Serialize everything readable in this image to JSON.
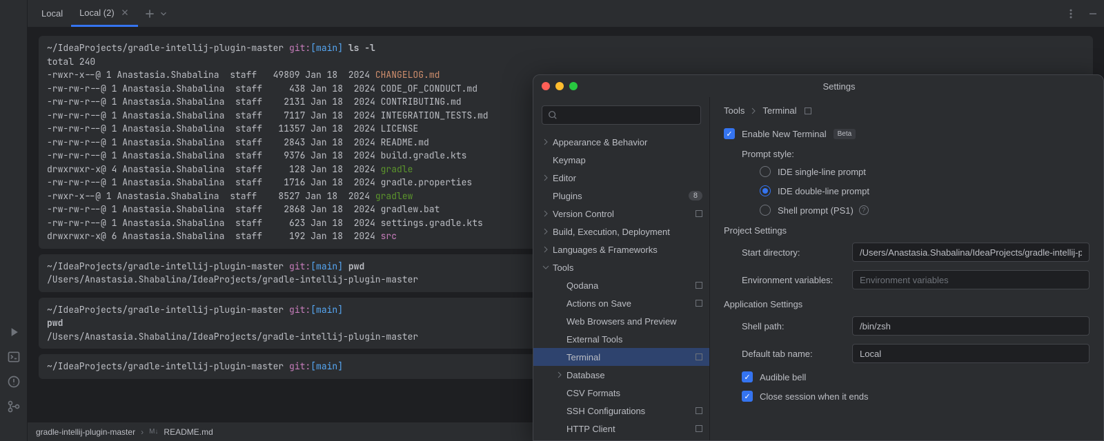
{
  "tabs": {
    "local_label": "Local",
    "local2_label": "Local (2)"
  },
  "terminal": {
    "prompt_path": "~/IdeaProjects/gradle-intellij-plugin-master",
    "git_label": "git:",
    "branch": "[main]",
    "cmd_ls": "ls -l",
    "cmd_pwd": "pwd",
    "total_line": "total 240",
    "pwd_output": "/Users/Anastasia.Shabalina/IdeaProjects/gradle-intellij-plugin-master",
    "files": [
      {
        "perm": "-rwxr-x--@",
        "n": "1",
        "owner": "Anastasia.Shabalina",
        "grp": "staff",
        "size": "49809",
        "date": "Jan 18  2024",
        "name": "CHANGELOG.md",
        "cls": "file-md"
      },
      {
        "perm": "-rw-rw-r--@",
        "n": "1",
        "owner": "Anastasia.Shabalina",
        "grp": "staff",
        "size": "438",
        "date": "Jan 18  2024",
        "name": "CODE_OF_CONDUCT.md",
        "cls": "file-reg"
      },
      {
        "perm": "-rw-rw-r--@",
        "n": "1",
        "owner": "Anastasia.Shabalina",
        "grp": "staff",
        "size": "2131",
        "date": "Jan 18  2024",
        "name": "CONTRIBUTING.md",
        "cls": "file-reg"
      },
      {
        "perm": "-rw-rw-r--@",
        "n": "1",
        "owner": "Anastasia.Shabalina",
        "grp": "staff",
        "size": "7117",
        "date": "Jan 18  2024",
        "name": "INTEGRATION_TESTS.md",
        "cls": "file-reg"
      },
      {
        "perm": "-rw-rw-r--@",
        "n": "1",
        "owner": "Anastasia.Shabalina",
        "grp": "staff",
        "size": "11357",
        "date": "Jan 18  2024",
        "name": "LICENSE",
        "cls": "file-reg"
      },
      {
        "perm": "-rw-rw-r--@",
        "n": "1",
        "owner": "Anastasia.Shabalina",
        "grp": "staff",
        "size": "2843",
        "date": "Jan 18  2024",
        "name": "README.md",
        "cls": "file-reg"
      },
      {
        "perm": "-rw-rw-r--@",
        "n": "1",
        "owner": "Anastasia.Shabalina",
        "grp": "staff",
        "size": "9376",
        "date": "Jan 18  2024",
        "name": "build.gradle.kts",
        "cls": "file-reg"
      },
      {
        "perm": "drwxrwxr-x@",
        "n": "4",
        "owner": "Anastasia.Shabalina",
        "grp": "staff",
        "size": "128",
        "date": "Jan 18  2024",
        "name": "gradle",
        "cls": "file-exec"
      },
      {
        "perm": "-rw-rw-r--@",
        "n": "1",
        "owner": "Anastasia.Shabalina",
        "grp": "staff",
        "size": "1716",
        "date": "Jan 18  2024",
        "name": "gradle.properties",
        "cls": "file-reg"
      },
      {
        "perm": "-rwxr-x--@",
        "n": "1",
        "owner": "Anastasia.Shabalina",
        "grp": "staff",
        "size": "8527",
        "date": "Jan 18  2024",
        "name": "gradlew",
        "cls": "file-exec"
      },
      {
        "perm": "-rw-rw-r--@",
        "n": "1",
        "owner": "Anastasia.Shabalina",
        "grp": "staff",
        "size": "2868",
        "date": "Jan 18  2024",
        "name": "gradlew.bat",
        "cls": "file-reg"
      },
      {
        "perm": "-rw-rw-r--@",
        "n": "1",
        "owner": "Anastasia.Shabalina",
        "grp": "staff",
        "size": "623",
        "date": "Jan 18  2024",
        "name": "settings.gradle.kts",
        "cls": "file-reg"
      },
      {
        "perm": "drwxrwxr-x@",
        "n": "6",
        "owner": "Anastasia.Shabalina",
        "grp": "staff",
        "size": "192",
        "date": "Jan 18  2024",
        "name": "src",
        "cls": "file-dir"
      }
    ]
  },
  "status": {
    "project": "gradle-intellij-plugin-master",
    "md_prefix": "M↓",
    "readme": "README.md"
  },
  "settings": {
    "title": "Settings",
    "breadcrumb": {
      "parent": "Tools",
      "current": "Terminal"
    },
    "tree": {
      "appearance": "Appearance & Behavior",
      "keymap": "Keymap",
      "editor": "Editor",
      "plugins": "Plugins",
      "plugins_badge": "8",
      "version_control": "Version Control",
      "build": "Build, Execution, Deployment",
      "languages": "Languages & Frameworks",
      "tools": "Tools",
      "qodana": "Qodana",
      "actions_save": "Actions on Save",
      "web_browsers": "Web Browsers and Preview",
      "external_tools": "External Tools",
      "terminal": "Terminal",
      "database": "Database",
      "csv": "CSV Formats",
      "ssh": "SSH Configurations",
      "http": "HTTP Client"
    },
    "form": {
      "enable_new": "Enable New Terminal",
      "beta": "Beta",
      "prompt_style": "Prompt style:",
      "radio_single": "IDE single-line prompt",
      "radio_double": "IDE double-line prompt",
      "radio_shell": "Shell prompt (PS1)",
      "project_settings": "Project Settings",
      "start_dir": "Start directory:",
      "start_dir_value": "/Users/Anastasia.Shabalina/IdeaProjects/gradle-intellij-plu",
      "env_vars": "Environment variables:",
      "env_placeholder": "Environment variables",
      "app_settings": "Application Settings",
      "shell_path": "Shell path:",
      "shell_path_value": "/bin/zsh",
      "default_tab": "Default tab name:",
      "default_tab_value": "Local",
      "audible": "Audible bell",
      "close_session": "Close session when it ends"
    }
  }
}
